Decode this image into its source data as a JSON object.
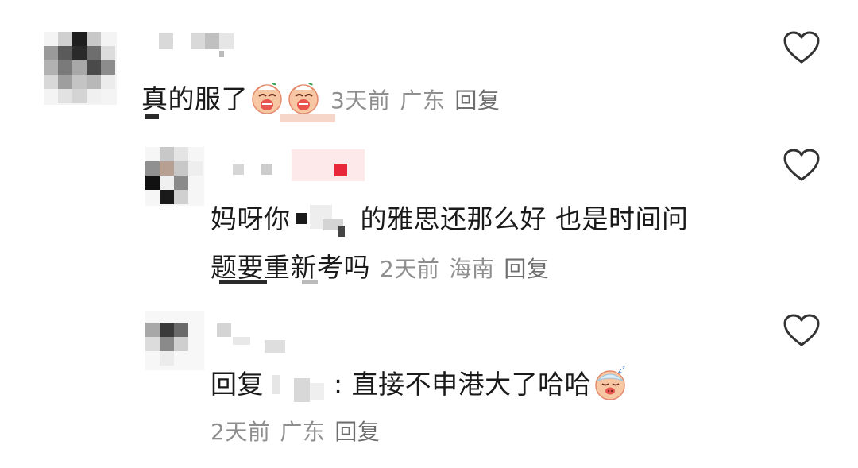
{
  "comments": [
    {
      "text": "真的服了",
      "time": "3天前",
      "location": "广东",
      "reply_label": "回复",
      "emoji": [
        "crying-emoji",
        "crying-emoji"
      ]
    },
    {
      "text_before": "妈呀你",
      "text_after": "的雅思还那么好 也是时间问",
      "text_line2": "题要重新考吗",
      "time": "2天前",
      "location": "海南",
      "reply_label": "回复"
    },
    {
      "reply_prefix": "回复",
      "text": ": 直接不申港大了哈哈",
      "emoji": [
        "sleeping-emoji"
      ],
      "time": "2天前",
      "location": "广东",
      "reply_label": "回复"
    }
  ],
  "icons": {
    "like": "heart-outline-icon"
  },
  "colors": {
    "text": "#1a1a1a",
    "meta": "#8e8e8e",
    "heart": "#333333",
    "redact_accent": "#e8283a"
  }
}
